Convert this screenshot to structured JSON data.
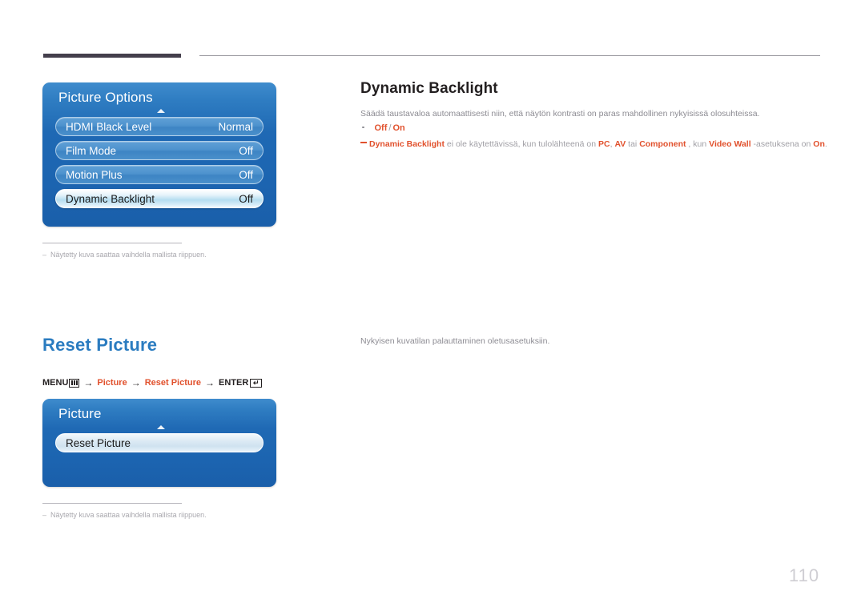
{
  "page": {
    "number": "110"
  },
  "header": {
    "bar_color": "#443f4c",
    "rule_color": "#9b9aa0"
  },
  "sections": [
    {
      "id": "dynamic-backlight",
      "heading": "Dynamic Backlight",
      "description": "Säädä taustavaloa automaattisesti niin, että näytön kontrasti on paras mahdollinen nykyisissä olosuhteissa.",
      "options": {
        "first": "Off",
        "separator": "/",
        "second": "On"
      },
      "note": {
        "term": "Dynamic Backlight",
        "t1": " ei ole käytettävissä, kun tulolähteenä on ",
        "b1": "PC",
        "t2": ", ",
        "b2": "AV",
        "t3": " tai ",
        "b3": "Component",
        "t4": " , kun ",
        "b4": "Video Wall",
        "t5": " -asetuksena on ",
        "b5": "On",
        "t6": "."
      },
      "osd": {
        "title": "Picture Options",
        "rows": [
          {
            "label": "HDMI Black Level",
            "value": "Normal",
            "selected": false
          },
          {
            "label": "Film Mode",
            "value": "Off",
            "selected": false
          },
          {
            "label": "Motion Plus",
            "value": "Off",
            "selected": false
          },
          {
            "label": "Dynamic Backlight",
            "value": "Off",
            "selected": true
          }
        ]
      },
      "footnote": "Näytetty kuva saattaa vaihdella mallista riippuen."
    },
    {
      "id": "reset-picture",
      "heading": "Reset Picture",
      "description": "Nykyisen kuvatilan palauttaminen oletusasetuksiin.",
      "menu_path": {
        "menu_label": "MENU",
        "menu_icon": "menu-grid-icon",
        "arrow": "→",
        "step1": "Picture",
        "step2": "Reset Picture",
        "enter_label": "ENTER",
        "enter_icon": "enter-key-icon",
        "enter_glyph": "↵"
      },
      "osd": {
        "title": "Picture",
        "rows": [
          {
            "label": "Reset Picture",
            "value": "",
            "selected": false,
            "plain": true
          }
        ]
      },
      "footnote": "Näytetty kuva saattaa vaihdella mallista riippuen."
    }
  ],
  "colors": {
    "heading_blue": "#2b7cc0",
    "accent_orange": "#e1512d",
    "body_gray": "#8d8c93",
    "osd_blue": "#1f69b4"
  }
}
